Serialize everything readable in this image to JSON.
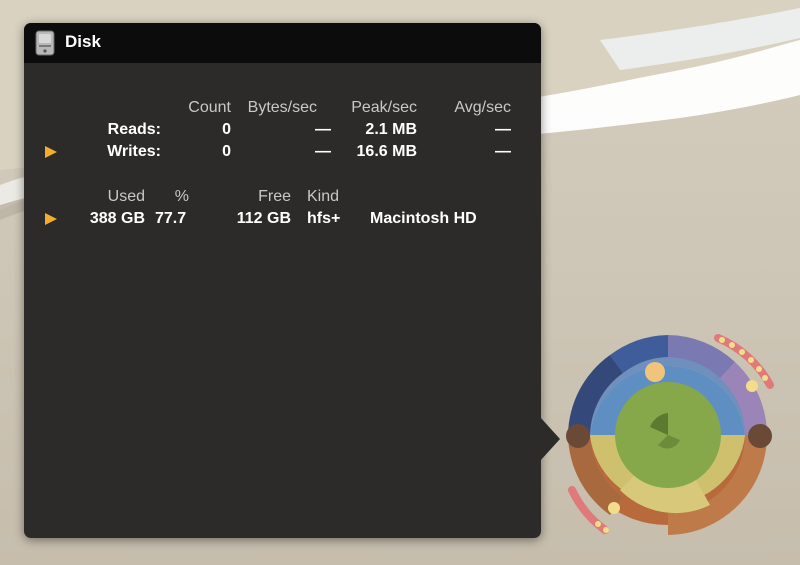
{
  "panel": {
    "title": "Disk",
    "icon": "disk-drive-icon"
  },
  "io": {
    "columns": [
      "Count",
      "Bytes/sec",
      "Peak/sec",
      "Avg/sec"
    ],
    "rows": [
      {
        "label": "Reads:",
        "count": "0",
        "bytes_sec": "—",
        "peak_sec": "2.1 MB",
        "avg_sec": "—",
        "expandable": false
      },
      {
        "label": "Writes:",
        "count": "0",
        "bytes_sec": "—",
        "peak_sec": "16.6 MB",
        "avg_sec": "—",
        "expandable": true
      }
    ]
  },
  "volumes": {
    "columns": [
      "Used",
      "%",
      "Free",
      "Kind"
    ],
    "rows": [
      {
        "used": "388 GB",
        "percent": "77.7",
        "free": "112 GB",
        "kind": "hfs+",
        "name": "Macintosh HD",
        "expandable": true
      }
    ]
  },
  "colors": {
    "panel_bg": "#2c2b29",
    "titlebar_bg": "#0c0c0c",
    "disclosure_arrow": "#f3ad2c"
  }
}
